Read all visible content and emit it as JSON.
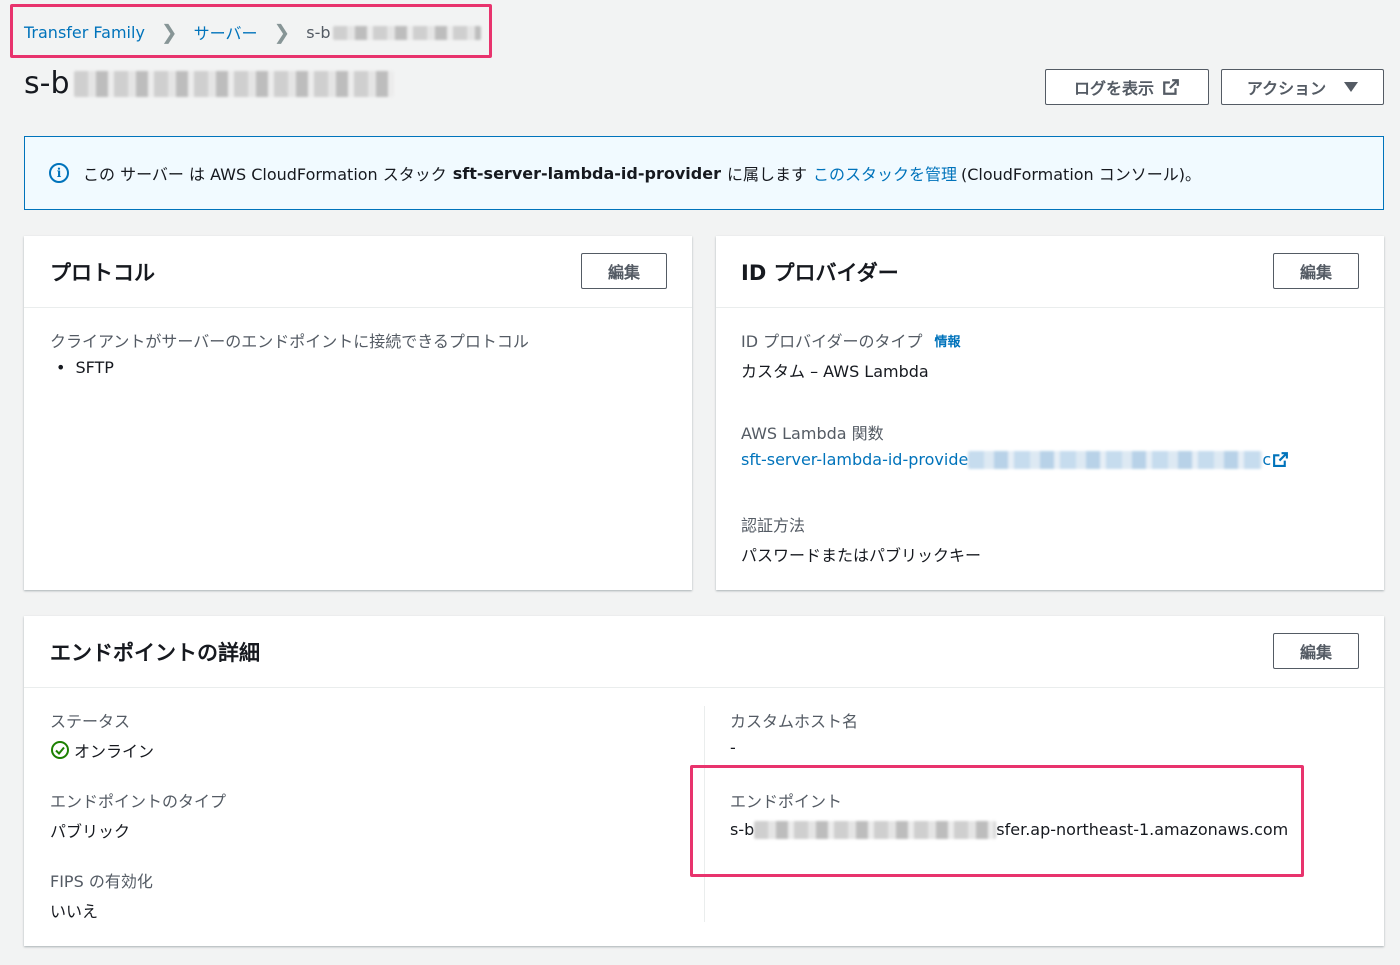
{
  "breadcrumb": {
    "items": [
      "Transfer Family",
      "サーバー"
    ],
    "current_prefix": "s-b"
  },
  "page": {
    "title_prefix": "s-b",
    "view_logs_label": "ログを表示",
    "actions_label": "アクション"
  },
  "banner": {
    "text_1": "この サーバー は AWS CloudFormation スタック",
    "stack_name": "sft-server-lambda-id-provider",
    "text_2": "に属します",
    "manage_link": "このスタックを管理",
    "text_3": "(CloudFormation コンソール)。"
  },
  "protocols": {
    "title": "プロトコル",
    "edit_label": "編集",
    "description": "クライアントがサーバーのエンドポイントに接続できるプロトコル",
    "items": [
      "SFTP"
    ]
  },
  "identity_provider": {
    "title": "ID プロバイダー",
    "edit_label": "編集",
    "type_label": "ID プロバイダーのタイプ",
    "info_label": "情報",
    "type_value": "カスタム – AWS Lambda",
    "lambda_label": "AWS Lambda 関数",
    "lambda_prefix": "sft-server-lambda-id-provide",
    "lambda_suffix": "c",
    "auth_label": "認証方法",
    "auth_value": "パスワードまたはパブリックキー"
  },
  "endpoint_details": {
    "title": "エンドポイントの詳細",
    "edit_label": "編集",
    "status_label": "ステータス",
    "status_value": "オンライン",
    "endpoint_type_label": "エンドポイントのタイプ",
    "endpoint_type_value": "パブリック",
    "fips_label": "FIPS の有効化",
    "fips_value": "いいえ",
    "custom_host_label": "カスタムホスト名",
    "custom_host_value": "-",
    "endpoint_label": "エンドポイント",
    "endpoint_prefix": "s-b",
    "endpoint_suffix": "sfer.ap-northeast-1.amazonaws.com"
  },
  "colors": {
    "link": "#0073bb",
    "highlight": "#e8336d",
    "success": "#1d8102",
    "background": "#f2f3f3"
  },
  "icons": [
    "external-link-icon",
    "caret-down-icon",
    "info-icon",
    "status-success-icon",
    "chevron-right-icon"
  ]
}
